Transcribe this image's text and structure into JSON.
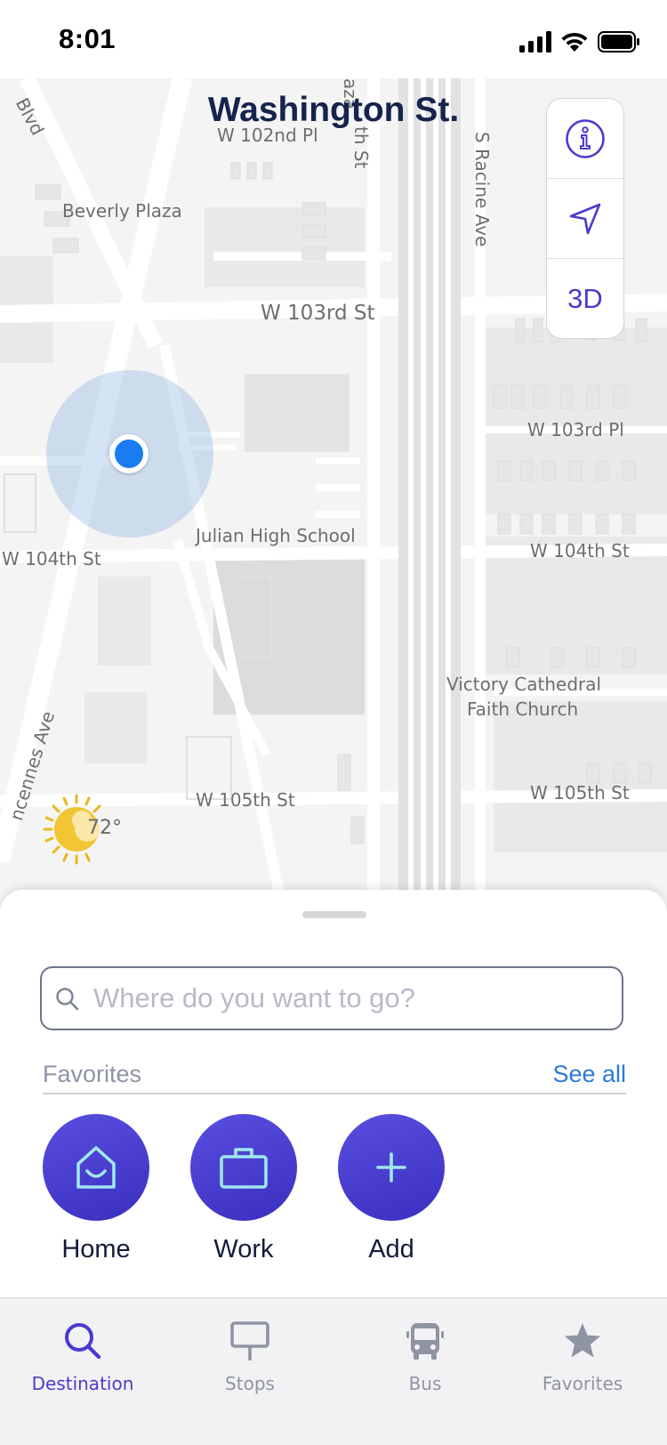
{
  "status_bar": {
    "time": "8:01"
  },
  "map": {
    "title": "Washington St.",
    "labels": [
      "Blvd",
      "W 102nd Pl",
      "aza",
      "th St",
      "S Racine Ave",
      "Beverly Plaza",
      "W 103rd St",
      "W 103rd Pl",
      "Julian High School",
      "W 104th St",
      "W 104th St",
      "ncennes Ave",
      "Victory Cathedral",
      "Faith Church",
      "W 105th St",
      "W 105th St"
    ],
    "controls": [
      {
        "name": "info-icon"
      },
      {
        "name": "navigate-arrow-icon"
      },
      {
        "label": "3D"
      }
    ],
    "weather": {
      "icon": "partly-sunny-icon",
      "temp": "72°"
    }
  },
  "sheet": {
    "search": {
      "placeholder": "Where do you want to go?",
      "value": ""
    },
    "favorites": {
      "title": "Favorites",
      "see_all": "See all",
      "items": [
        {
          "label": "Home",
          "icon": "home-smile-icon"
        },
        {
          "label": "Work",
          "icon": "briefcase-icon"
        },
        {
          "label": "Add",
          "icon": "plus-icon"
        }
      ]
    }
  },
  "tabbar": {
    "items": [
      {
        "label": "Destination",
        "icon": "search-icon",
        "active": true
      },
      {
        "label": "Stops",
        "icon": "sign-icon",
        "active": false
      },
      {
        "label": "Bus",
        "icon": "bus-icon",
        "active": false
      },
      {
        "label": "Favorites",
        "icon": "star-icon",
        "active": false
      }
    ]
  },
  "colors": {
    "accent": "#4a3ccb",
    "title": "#16234c",
    "link": "#2b79d8",
    "location_dot": "#1a7cf0"
  }
}
